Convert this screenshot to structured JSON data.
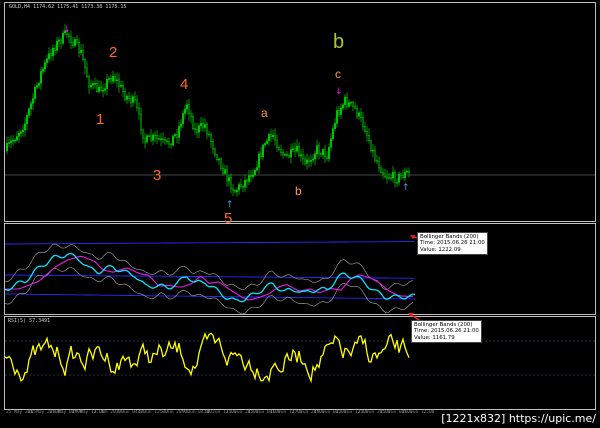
{
  "chart": {
    "symbol_header": "GOLD,H4  1174.62 1175.41 1173.38 1175.15",
    "rsi_title": "RSI(5) 57.3491",
    "wave_labels": [
      "1",
      "2",
      "3",
      "4",
      "5",
      "a",
      "b",
      "c",
      "b"
    ],
    "x_axis_labels": [
      "25 May 2015",
      "26 May 20:00",
      "28 May 04:00",
      "29 May 12:00",
      "1 Jun 20:00",
      "3 Jun 04:00",
      "4 Jun 12:00",
      "5 Jun 20:00",
      "9 Jun 04:00",
      "10 Jun 12:00",
      "11 Jun 20:00",
      "15 Jun 04:00",
      "16 Jun 12:00",
      "17 Jun 20:00",
      "19 Jun 04:00",
      "22 Jun 12:00",
      "23 Jun 20:00",
      "25 Jun 04:00",
      "26 Jun 12:00"
    ],
    "colors": {
      "background": "#000000",
      "candle": "#00c800",
      "wave_orange": "#ff6a1a",
      "wave_light_orange": "#ff9a3c",
      "wave_b_green": "#a8c832",
      "bb_band": "#2828ff",
      "bb_gray": "#aaaaaa",
      "cyan": "#00e6ff",
      "magenta": "#e61ee6",
      "rsi": "#ffff00",
      "up_arrow": "#3aa0ff",
      "down_arrow": "#ff00ff"
    }
  },
  "tooltips": {
    "upper": {
      "title": "Bollinger Bands (200)",
      "time": "Time: 2015.06.26 21:00",
      "value": "Value: 1222.09"
    },
    "lower": {
      "title": "Bollinger Bands (200)",
      "time": "Time: 2015.06.26 21:00",
      "value": "Value: 1161.79"
    }
  },
  "watermark": "[1221x832] https://upic.me/"
}
